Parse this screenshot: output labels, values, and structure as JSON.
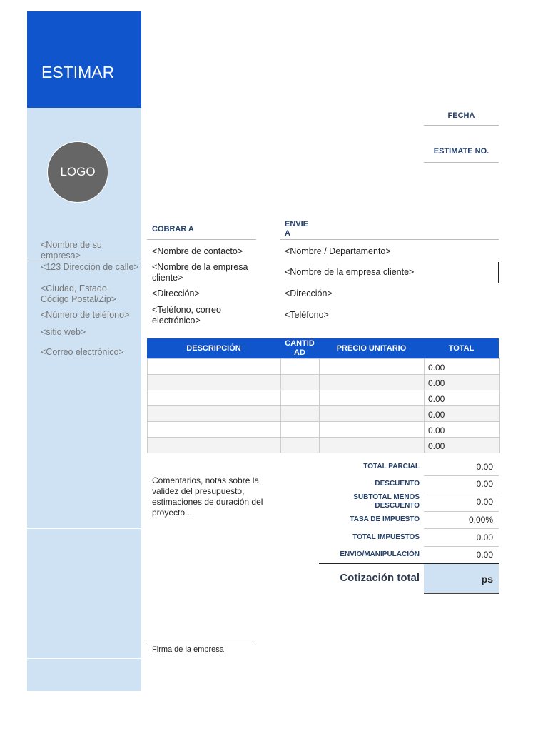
{
  "header": {
    "title": "ESTIMAR",
    "logo": "LOGO"
  },
  "company": [
    "<Nombre de su empresa>",
    "<123 Dirección de calle>",
    "<Ciudad, Estado, Código Postal/Zip>",
    "<Número de teléfono>",
    "<sitio web>",
    "<Correo electrónico>"
  ],
  "meta": {
    "date_label": "FECHA",
    "estimate_label": "ESTIMATE NO."
  },
  "bill_to": {
    "label": "COBRAR A",
    "lines": [
      "<Nombre de contacto>",
      "<Nombre de la empresa cliente>",
      "<Dirección>",
      "<Teléfono, correo electrónico>"
    ]
  },
  "ship_to": {
    "label": "ENVIE A",
    "lines": [
      "<Nombre / Departamento>",
      "<Nombre de la empresa cliente>",
      "<Dirección>",
      "<Teléfono>"
    ]
  },
  "table": {
    "headers": [
      "DESCRIPCIÓN",
      "CANTIDAD",
      "PRECIO UNITARIO",
      "TOTAL"
    ],
    "totals": [
      "0.00",
      "0.00",
      "0.00",
      "0.00",
      "0.00",
      "0.00"
    ]
  },
  "notes": "Comentarios, notas sobre la validez del presupuesto, estimaciones de duración del proyecto...",
  "summary": [
    {
      "label": "TOTAL PARCIAL",
      "value": "0.00"
    },
    {
      "label": "DESCUENTO",
      "value": "0.00"
    },
    {
      "label": "SUBTOTAL MENOS DESCUENTO",
      "value": "0.00"
    },
    {
      "label": "TASA DE IMPUESTO",
      "value": "0,00%"
    },
    {
      "label": "TOTAL IMPUESTOS",
      "value": "0.00"
    },
    {
      "label": "ENVÍO/MANIPULACIÓN",
      "value": "0.00"
    }
  ],
  "grand_total": {
    "label": "Cotización total",
    "value": "ps"
  },
  "signature": "Firma de la empresa"
}
